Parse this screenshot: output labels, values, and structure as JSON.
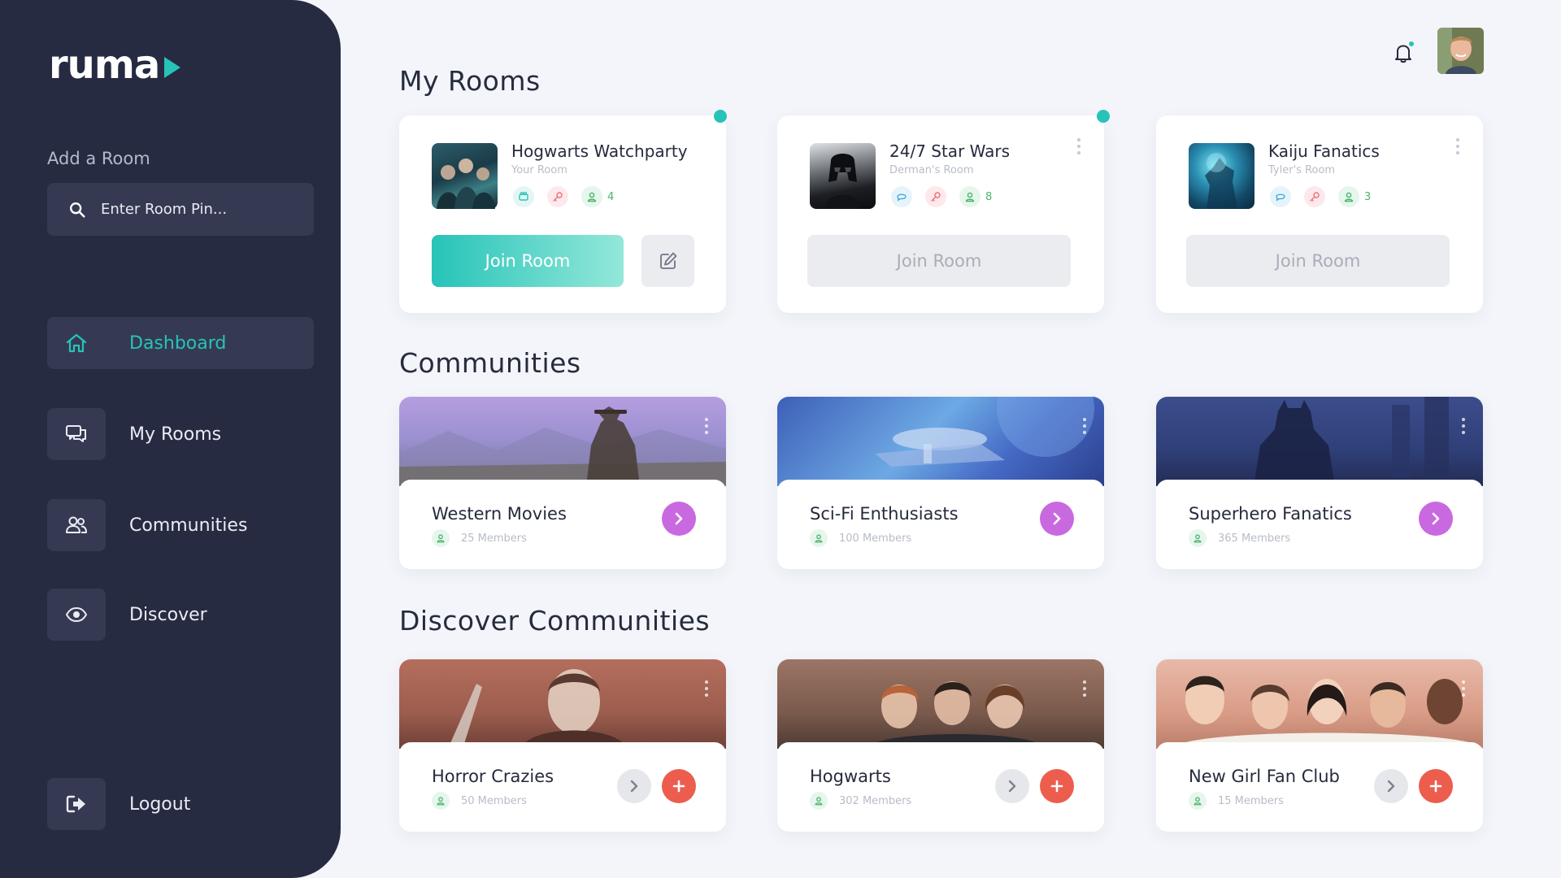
{
  "sidebar": {
    "logo": "ruma",
    "add_room_label": "Add a Room",
    "room_pin_placeholder": "Enter Room Pin...",
    "nav": [
      {
        "label": "Dashboard",
        "icon": "home-icon",
        "active": true
      },
      {
        "label": "My Rooms",
        "icon": "chat-bubbles-icon",
        "active": false
      },
      {
        "label": "Communities",
        "icon": "users-icon",
        "active": false
      },
      {
        "label": "Discover",
        "icon": "eye-icon",
        "active": false
      }
    ],
    "logout_label": "Logout"
  },
  "header": {
    "notification_icon": "bell-icon",
    "avatar_icon": "user-avatar"
  },
  "my_rooms": {
    "title": "My Rooms",
    "rooms": [
      {
        "name": "Hogwarts Watchparty",
        "owner": "Your Room",
        "members": "4",
        "join_label": "Join Room",
        "live": true,
        "joinable": true
      },
      {
        "name": "24/7 Star Wars",
        "owner": "Derman's Room",
        "members": "8",
        "join_label": "Join Room",
        "live": true,
        "joinable": false
      },
      {
        "name": "Kaiju Fanatics",
        "owner": "Tyler's Room",
        "members": "3",
        "join_label": "Join Room",
        "live": false,
        "joinable": false
      }
    ]
  },
  "communities": {
    "title": "Communities",
    "items": [
      {
        "name": "Western Movies",
        "members": "25 Members"
      },
      {
        "name": "Sci-Fi Enthusiasts",
        "members": "100 Members"
      },
      {
        "name": "Superhero Fanatics",
        "members": "365 Members"
      }
    ]
  },
  "discover": {
    "title": "Discover Communities",
    "items": [
      {
        "name": "Horror Crazies",
        "members": "50 Members"
      },
      {
        "name": "Hogwarts",
        "members": "302 Members"
      },
      {
        "name": "New Girl Fan Club",
        "members": "15 Members"
      }
    ]
  },
  "colors": {
    "sidebar": "#262b42",
    "accent": "#27c3b9",
    "purple": "#c969e0",
    "red": "#ec5d4d",
    "background": "#f3f5fa"
  }
}
